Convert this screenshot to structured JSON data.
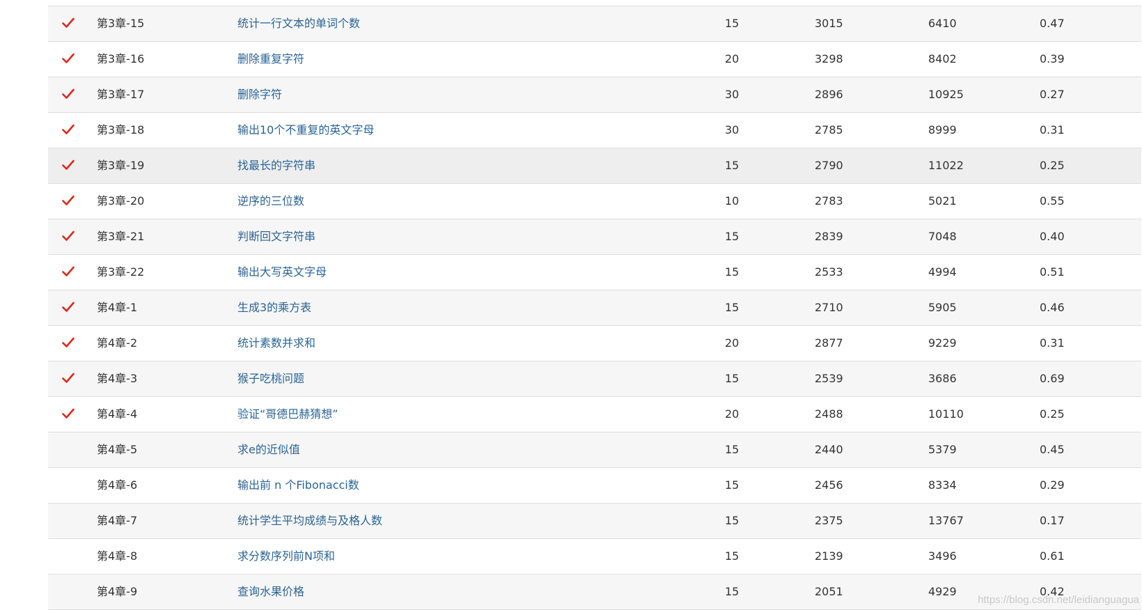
{
  "colors": {
    "check": "#e0261a",
    "link": "#2a6496",
    "stripe": "#f6f6f6",
    "border": "#dddddd"
  },
  "rows": [
    {
      "solved": true,
      "id": "第3章-15",
      "title": "统计一行文本的单词个数",
      "score": "15",
      "accepted": "3015",
      "submits": "6410",
      "ratio": "0.47"
    },
    {
      "solved": true,
      "id": "第3章-16",
      "title": "删除重复字符",
      "score": "20",
      "accepted": "3298",
      "submits": "8402",
      "ratio": "0.39"
    },
    {
      "solved": true,
      "id": "第3章-17",
      "title": "删除字符",
      "score": "30",
      "accepted": "2896",
      "submits": "10925",
      "ratio": "0.27"
    },
    {
      "solved": true,
      "id": "第3章-18",
      "title": "输出10个不重复的英文字母",
      "score": "30",
      "accepted": "2785",
      "submits": "8999",
      "ratio": "0.31"
    },
    {
      "solved": true,
      "id": "第3章-19",
      "title": "找最长的字符串",
      "score": "15",
      "accepted": "2790",
      "submits": "11022",
      "ratio": "0.25"
    },
    {
      "solved": true,
      "id": "第3章-20",
      "title": "逆序的三位数",
      "score": "10",
      "accepted": "2783",
      "submits": "5021",
      "ratio": "0.55"
    },
    {
      "solved": true,
      "id": "第3章-21",
      "title": "判断回文字符串",
      "score": "15",
      "accepted": "2839",
      "submits": "7048",
      "ratio": "0.40"
    },
    {
      "solved": true,
      "id": "第3章-22",
      "title": "输出大写英文字母",
      "score": "15",
      "accepted": "2533",
      "submits": "4994",
      "ratio": "0.51"
    },
    {
      "solved": true,
      "id": "第4章-1",
      "title": "生成3的乘方表",
      "score": "15",
      "accepted": "2710",
      "submits": "5905",
      "ratio": "0.46"
    },
    {
      "solved": true,
      "id": "第4章-2",
      "title": "统计素数并求和",
      "score": "20",
      "accepted": "2877",
      "submits": "9229",
      "ratio": "0.31"
    },
    {
      "solved": true,
      "id": "第4章-3",
      "title": "猴子吃桃问题",
      "score": "15",
      "accepted": "2539",
      "submits": "3686",
      "ratio": "0.69"
    },
    {
      "solved": true,
      "id": "第4章-4",
      "title": "验证“哥德巴赫猜想”",
      "score": "20",
      "accepted": "2488",
      "submits": "10110",
      "ratio": "0.25"
    },
    {
      "solved": false,
      "id": "第4章-5",
      "title": "求e的近似值",
      "score": "15",
      "accepted": "2440",
      "submits": "5379",
      "ratio": "0.45"
    },
    {
      "solved": false,
      "id": "第4章-6",
      "title": "输出前 n 个Fibonacci数",
      "score": "15",
      "accepted": "2456",
      "submits": "8334",
      "ratio": "0.29"
    },
    {
      "solved": false,
      "id": "第4章-7",
      "title": "统计学生平均成绩与及格人数",
      "score": "15",
      "accepted": "2375",
      "submits": "13767",
      "ratio": "0.17"
    },
    {
      "solved": false,
      "id": "第4章-8",
      "title": "求分数序列前N项和",
      "score": "15",
      "accepted": "2139",
      "submits": "3496",
      "ratio": "0.61"
    },
    {
      "solved": false,
      "id": "第4章-9",
      "title": "查询水果价格",
      "score": "15",
      "accepted": "2051",
      "submits": "4929",
      "ratio": "0.42"
    }
  ],
  "watermark": "https://blog.csdn.net/leidianguagua"
}
